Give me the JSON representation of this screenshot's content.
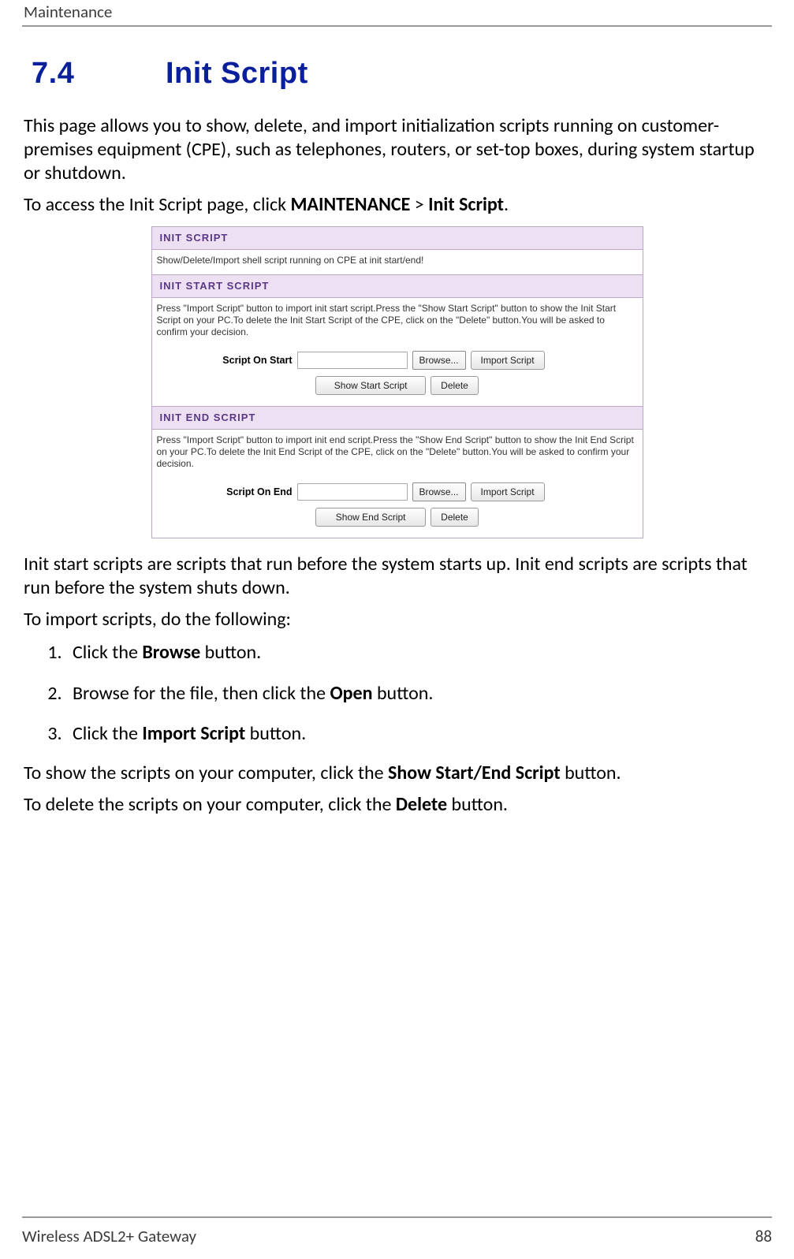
{
  "header": {
    "section": "Maintenance"
  },
  "heading": {
    "number": "7.4",
    "title": "Init Script"
  },
  "intro": {
    "p1": "This page allows you to show, delete, and import initialization scripts running on customer-premises equipment (CPE), such as telephones, routers, or set-top boxes, during system startup or shutdown.",
    "p2_prefix": "To access the Init Script page, click ",
    "p2_b1": "MAINTENANCE",
    "p2_mid": " > ",
    "p2_b2": "Init Script",
    "p2_suffix": "."
  },
  "ui": {
    "init_script": {
      "title": "INIT SCRIPT",
      "desc": "Show/Delete/Import shell script running on CPE at init start/end!"
    },
    "start": {
      "title": "INIT START SCRIPT",
      "desc": "Press \"Import Script\" button to import init start script.Press the \"Show Start Script\" button to show the Init Start Script on your PC.To delete the Init Start Script of the CPE, click on the \"Delete\" button.You will be asked to confirm your decision.",
      "label": "Script On Start",
      "browse": "Browse...",
      "import": "Import Script",
      "show": "Show Start Script",
      "delete": "Delete"
    },
    "end": {
      "title": "INIT END SCRIPT",
      "desc": "Press \"Import Script\" button to import init end script.Press the \"Show End Script\" button to show the Init End Script on your PC.To delete the Init End Script of the CPE, click on the \"Delete\" button.You will be asked to confirm your decision.",
      "label": "Script On End",
      "browse": "Browse...",
      "import": "Import Script",
      "show": "Show End Script",
      "delete": "Delete"
    }
  },
  "after": {
    "p1": "Init start scripts are scripts that run before the system starts up. Init end scripts are scripts that run before the system shuts down.",
    "p2": "To import scripts, do the following:"
  },
  "steps": {
    "s1_pre": "Click the ",
    "s1_b": "Browse",
    "s1_post": " button.",
    "s2_pre": "Browse for the file, then click the ",
    "s2_b": "Open",
    "s2_post": " button.",
    "s3_pre": "Click the ",
    "s3_b": "Import Script",
    "s3_post": " button."
  },
  "tail": {
    "show_pre": "To show the scripts on your computer, click the ",
    "show_b": "Show Start/End Script",
    "show_post": " button.",
    "del_pre": "To delete the scripts on your computer, click the ",
    "del_b": "Delete",
    "del_post": " button."
  },
  "footer": {
    "product": "Wireless ADSL2+ Gateway",
    "page": "88"
  }
}
